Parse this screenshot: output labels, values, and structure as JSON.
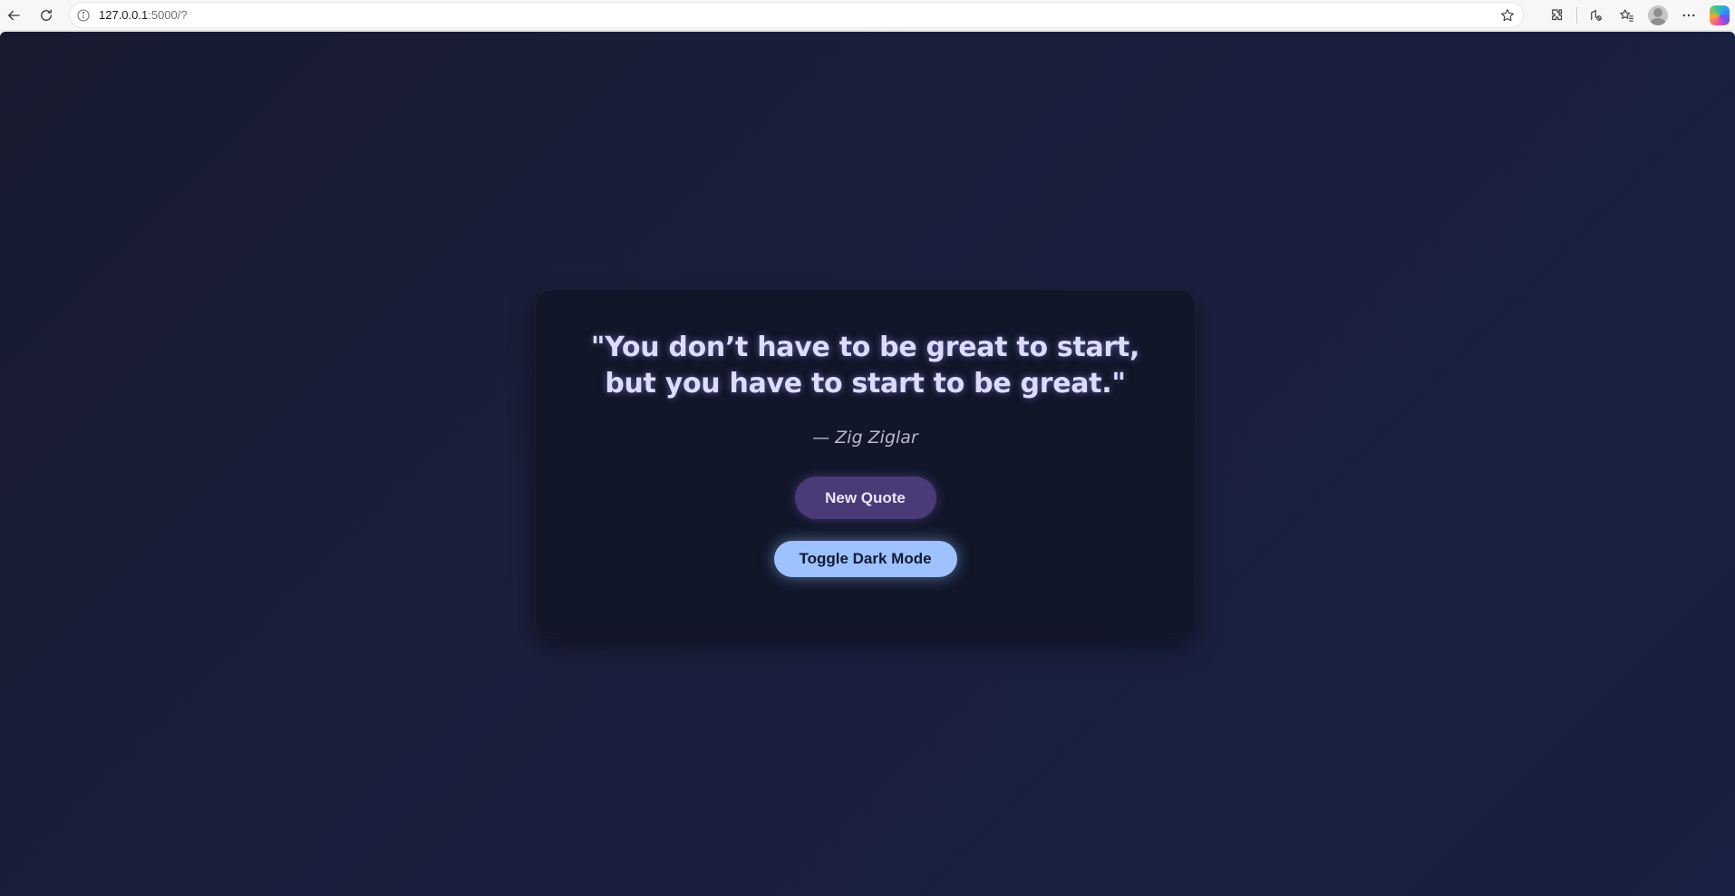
{
  "browser": {
    "url_host": "127.0.0.1",
    "url_rest": ":5000/?",
    "icons": {
      "back": "back-arrow-icon",
      "reload": "reload-icon",
      "info": "site-info-icon",
      "favorite": "star-icon",
      "extensions": "extensions-icon",
      "read_aloud": "read-aloud-icon",
      "favorites": "favorites-icon",
      "profile": "profile-avatar",
      "more": "more-icon",
      "copilot": "copilot-icon"
    }
  },
  "quote": {
    "text": "\"You don’t have to be great to start, but you have to start to be great.\"",
    "author": "— Zig Ziglar"
  },
  "buttons": {
    "new_quote": "New Quote",
    "toggle_dark_mode": "Toggle Dark Mode"
  },
  "colors": {
    "background": "#1a1f3d",
    "card": "#10142a",
    "quote_text": "#dcdcfb",
    "new_quote_button": "#4a3a78",
    "toggle_button": "#9ec2ff"
  }
}
